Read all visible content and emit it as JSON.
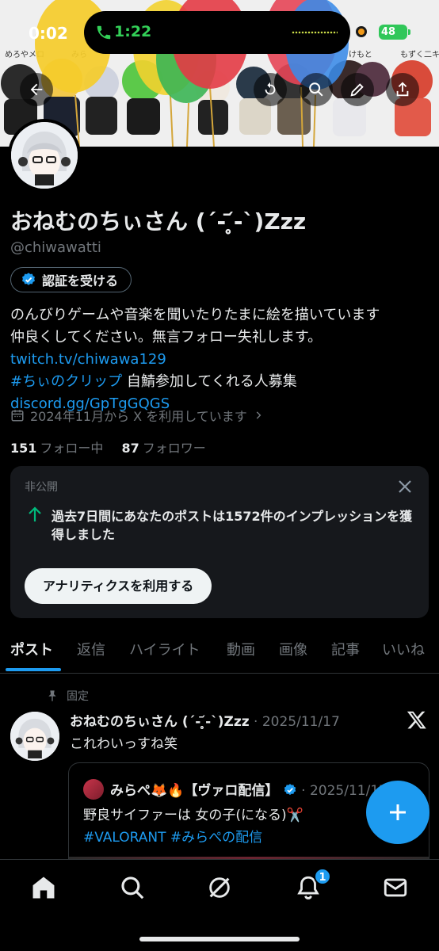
{
  "status_bar": {
    "time": "0:02",
    "call_time": "1:22",
    "battery": "48"
  },
  "profile": {
    "name": "おねむのちぃさん (´- ̥̥᷄-`)Zzz",
    "handle": "@chiwawatti",
    "verify_label": "認証を受ける",
    "bio_line1": "のんびりゲームや音楽を聞いたりたまに絵を描いています",
    "bio_line2": "仲良くしてください。無言フォロー失礼します。",
    "bio_link1": "twitch.tv/chiwawa129",
    "bio_hashtag": "#ちぃのクリップ",
    "bio_line3": " 自鯖参加してくれる人募集",
    "bio_link2": "discord.gg/GpTgGQGS",
    "joined": "2024年11月から X を利用しています",
    "following_count": "151",
    "following_label": "フォロー中",
    "followers_count": "87",
    "followers_label": "フォロワー"
  },
  "private_card": {
    "label": "非公開",
    "message": "過去7日間にあなたのポストは1572件のインプレッションを獲得しました",
    "button": "アナリティクスを利用する"
  },
  "tabs": [
    "ポスト",
    "返信",
    "ハイライト",
    "動画",
    "画像",
    "記事",
    "いいね"
  ],
  "tweet": {
    "pinned_label": "固定",
    "author": "おねむのちぃさん (´- ̥̥᷄-`)Zzz",
    "date": "· 2025/11/17",
    "text": "これわいっすね笑",
    "quote": {
      "author": "みらぺ🦊🔥【ヴァロ配信】",
      "date": "· 2025/11/17",
      "text": "野良サイファーは 女の子(になる)✂️",
      "hashtags": "#VALORANT #みらぺの配信"
    }
  },
  "nav": {
    "notification_badge": "1"
  },
  "colors": {
    "accent": "#1d9bf0",
    "background": "#000000",
    "text": "#e7e9ea",
    "muted": "#71767b"
  }
}
